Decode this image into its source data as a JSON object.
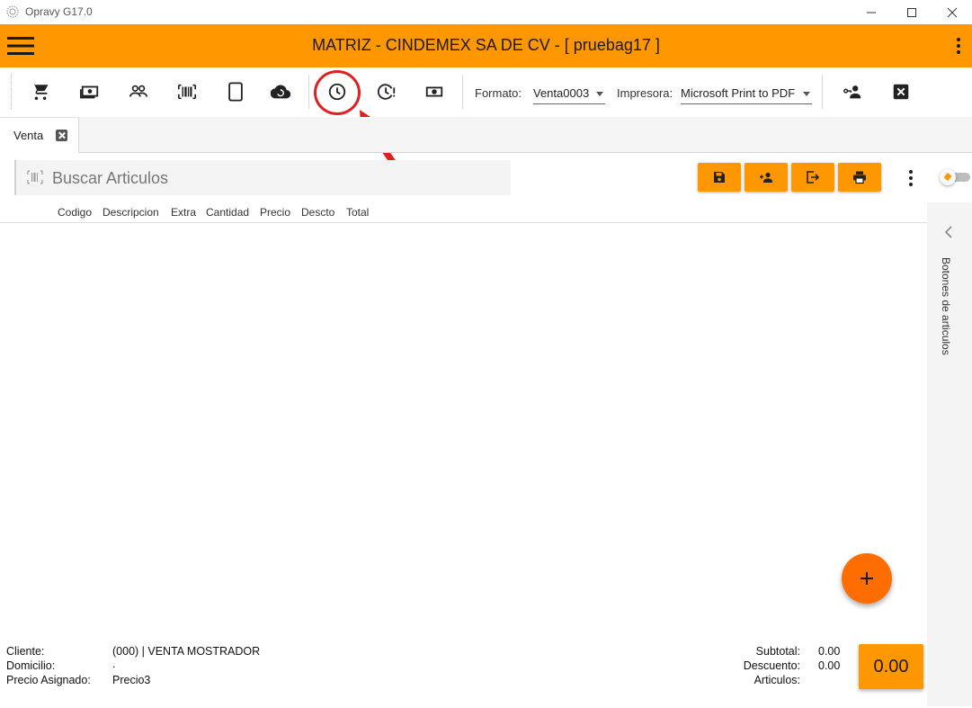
{
  "window": {
    "title": "Opravy G17.0"
  },
  "header": {
    "title": "MATRIZ - CINDEMEX SA DE CV - [ pruebag17 ]"
  },
  "toolbar": {
    "icons": [
      "cart-icon",
      "cash-icon",
      "people-icon",
      "barcode-icon",
      "tablet-icon",
      "cloud-sync-icon",
      "clock-icon",
      "clock-alert-icon",
      "money-icon",
      "user-key-icon",
      "close-box-icon"
    ],
    "formato_label": "Formato:",
    "formato_value": "Venta0003",
    "impresora_label": "Impresora:",
    "impresora_value": "Microsoft Print to PDF"
  },
  "tabs": [
    {
      "label": "Venta"
    }
  ],
  "search": {
    "placeholder": "Buscar Articulos"
  },
  "grid": {
    "columns": [
      "Codigo",
      "Descripcion",
      "Extra",
      "Cantidad",
      "Precio",
      "Descto",
      "Total"
    ],
    "rows": []
  },
  "side_panel": {
    "label": "Botones de articulos"
  },
  "footer": {
    "cliente_label": "Cliente:",
    "cliente_value": "(000) | VENTA MOSTRADOR",
    "domicilio_label": "Domicilio:",
    "domicilio_value": ".",
    "precio_label": "Precio Asignado:",
    "precio_value": "Precio3",
    "subtotal_label": "Subtotal:",
    "subtotal_value": "0.00",
    "descuento_label": "Descuento:",
    "descuento_value": "0.00",
    "articulos_label": "Articulos:",
    "articulos_value": "",
    "total": "0.00"
  },
  "colors": {
    "accent": "#ff9800",
    "fab": "#ff6d00",
    "highlight": "#e02020"
  }
}
